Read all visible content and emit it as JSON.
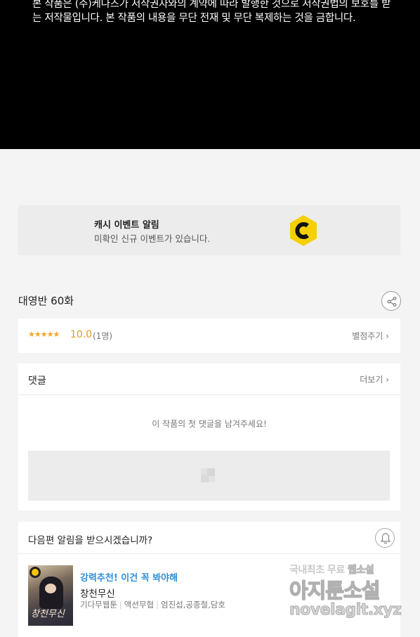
{
  "notice": {
    "text": "본 작품은 (주)케나즈가 저작권자와의 계약에 따라 발행한 것으로 저작권법의 보호를 받는 저작물입니다. 본 작품의 내용을 무단 전재 및 무단 복제하는 것을 금합니다."
  },
  "cash_event": {
    "title": "캐시 이벤트 알림",
    "subtitle": "미확인 신규 이벤트가 있습니다.",
    "icon": "c-coin-icon",
    "accent": "#f5d000"
  },
  "episode": {
    "title": "대영반 60화",
    "share_icon": "share-icon"
  },
  "rating": {
    "stars_text": "★★★★★",
    "stars_value": 5,
    "score": "10.0",
    "count": "(1명)",
    "rate_link": "별점주기 ›",
    "star_color": "#f5a623"
  },
  "comments": {
    "title": "댓글",
    "more_link": "더보기 ›",
    "empty_message": "이 작품의 첫 댓글을 남겨주세요!"
  },
  "next_alarm": {
    "title": "다음편 알림을 받으시겠습니까?",
    "bell_icon": "bell-icon"
  },
  "recommendation": {
    "promo": "강력추천! 이건 꼭 봐야해",
    "title": "창천무신",
    "thumb_logo": "창천무신",
    "meta": [
      "기다무웹툰",
      "액션무협",
      "엄진섭,공종철,담호"
    ],
    "promo_color": "#2f8fd8"
  },
  "watermark": {
    "line1_a": "국내최초 무료 ",
    "line1_b": "웹소설",
    "line2_a": "아지툰",
    "line2_b": "소설",
    "line3": "novelagit.xyz"
  }
}
